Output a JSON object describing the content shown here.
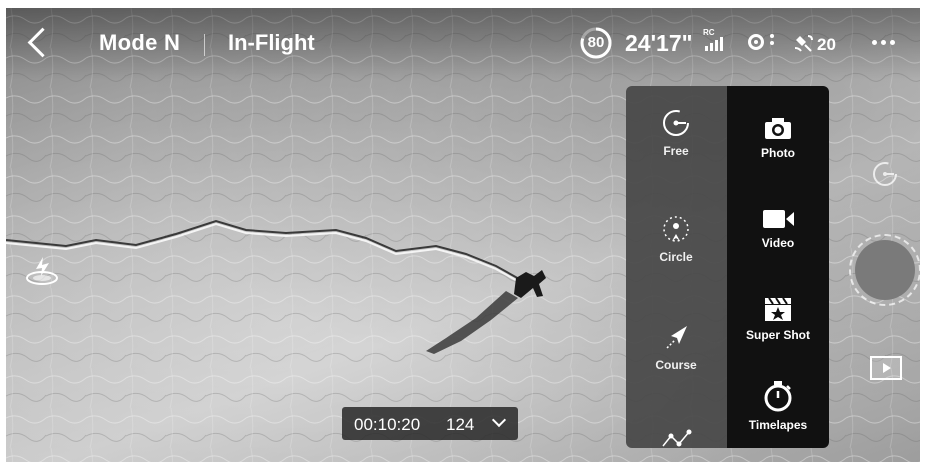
{
  "header": {
    "flight_mode": "Mode N",
    "flight_state": "In-Flight",
    "battery_percent": "80",
    "remaining_time": "24'17\"",
    "rc_label": "RC",
    "gps_satellites": "20"
  },
  "menu": {
    "left_items": [
      {
        "label": "Free",
        "icon": "free-mode-icon"
      },
      {
        "label": "Circle",
        "icon": "circle-mode-icon"
      },
      {
        "label": "Course",
        "icon": "course-mode-icon"
      }
    ],
    "right_items": [
      {
        "label": "Photo",
        "icon": "camera-icon"
      },
      {
        "label": "Video",
        "icon": "video-icon"
      },
      {
        "label": "Super Shot",
        "icon": "clapperboard-icon"
      },
      {
        "label": "Timelapes",
        "icon": "stopwatch-icon"
      }
    ]
  },
  "readout": {
    "time": "00:10:20",
    "count": "124"
  },
  "colors": {
    "menu_left_bg": "#464646",
    "menu_right_bg": "#111111",
    "shutter": "#7a7a7a"
  }
}
